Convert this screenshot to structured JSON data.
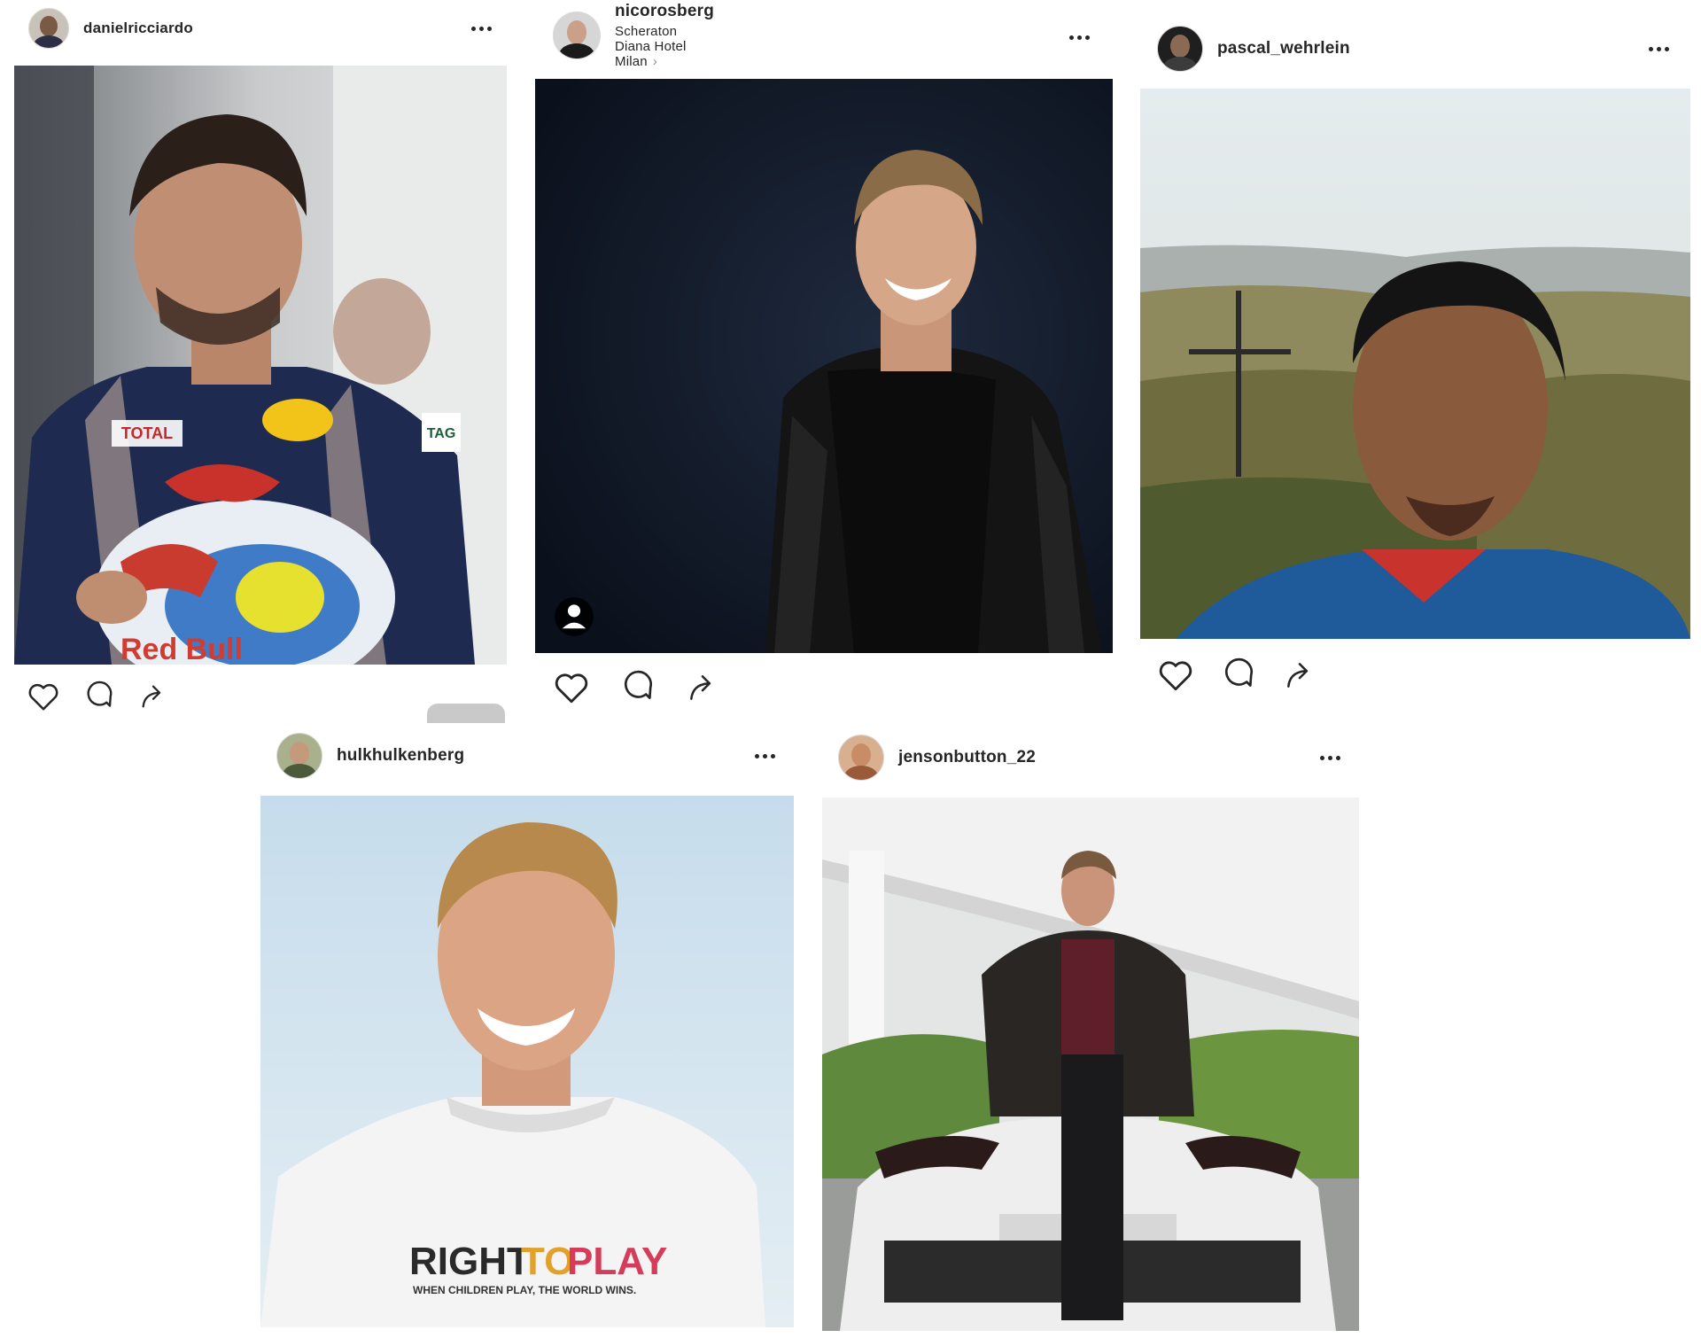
{
  "posts": [
    {
      "username": "danielricciardo",
      "location": "",
      "avatar_color": "#5a4a3f"
    },
    {
      "username": "nicorosberg",
      "location": "Scheraton Diana Hotel Milan",
      "avatar_color": "#3a3a3a"
    },
    {
      "username": "pascal_wehrlein",
      "location": "",
      "avatar_color": "#2a2a2a"
    },
    {
      "username": "hulkhulkenberg",
      "location": "",
      "avatar_color": "#4d5b3c"
    },
    {
      "username": "jensonbutton_22",
      "location": "",
      "avatar_color": "#b27a52"
    }
  ],
  "photo_text": {
    "suit_sponsor_1": "TOTAL",
    "suit_sponsor_2": "TAG",
    "helmet_brand": "Red Bull",
    "shirt_right": "RIGHT",
    "shirt_to": "TO",
    "shirt_play": "PLAY",
    "shirt_tagline": "WHEN CHILDREN PLAY, THE WORLD WINS."
  },
  "icons": {
    "like": "heart-icon",
    "comment": "comment-icon",
    "share": "share-icon",
    "more": "more-icon",
    "tagged": "user-tag-icon"
  },
  "colors": {
    "text": "#262626",
    "muted": "#8e8e8e",
    "background": "#ffffff"
  }
}
